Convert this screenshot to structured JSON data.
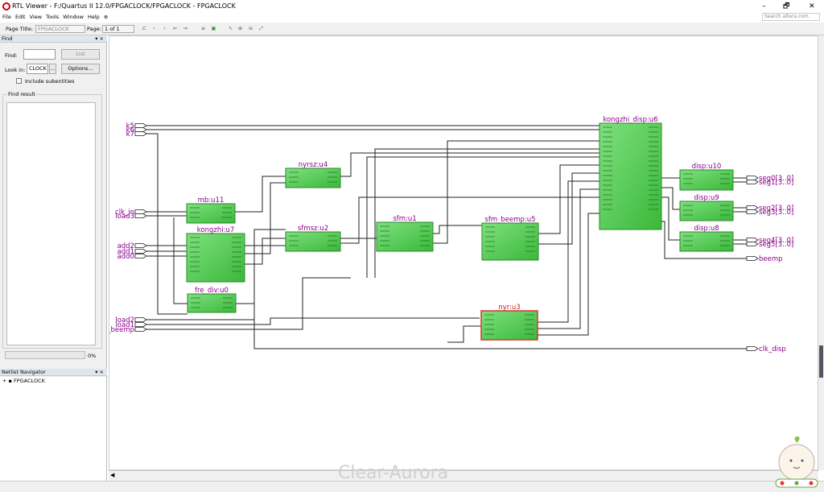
{
  "window": {
    "title": "RTL Viewer - F:/Quartus II 12.0/FPGACLOCK/FPGACLOCK - FPGACLOCK",
    "minimize": "–",
    "maximize": "🗗",
    "close": "✕"
  },
  "menu": [
    "File",
    "Edit",
    "View",
    "Tools",
    "Window",
    "Help",
    "⊕"
  ],
  "search_placeholder": "Search altera.com",
  "toolbar": {
    "page_title_label": "Page Title:",
    "page_title_value": "FPGACLOCK",
    "page_label": "Page:",
    "page_value": "1 of 1"
  },
  "find_panel": {
    "header": "Find",
    "find_label": "Find:",
    "list_button": "List",
    "look_in_label": "Look in:",
    "look_in_value": "CLOCK",
    "browse_button": "...",
    "options_button": "Options...",
    "include_subentities": "Include subentities",
    "find_result_label": "Find result",
    "progress": "0%"
  },
  "netlist_panel": {
    "header": "Netlist Navigator",
    "root": "FPGACLOCK"
  },
  "schematic": {
    "inputs_left": [
      "k5",
      "k6",
      "k7",
      "clk_in",
      "load3",
      "add2",
      "add1",
      "add0",
      "load2",
      "load1",
      "rl_beemp"
    ],
    "outputs_right": [
      "seg0[3..0]",
      "seg1[3..0]",
      "seg2[3..0]",
      "seg3[3..0]",
      "seg4[3..0]",
      "seg5[3..0]",
      "beemp",
      "clk_disp"
    ],
    "blocks": [
      "mb:u11",
      "kongzhi:u7",
      "fre_div:u0",
      "nyrsz:u4",
      "sfmsz:u2",
      "sfm:u1",
      "sfm_beemp:u5",
      "nyr:u3",
      "kongzhi_disp:u6",
      "disp:u10",
      "disp:u9",
      "disp:u8"
    ]
  },
  "watermark": "Clear-Aurora",
  "colors": {
    "block_fill": "#4cc94c",
    "block_border": "#2a8a2a",
    "port_text": "#8b008b",
    "highlight_border": "#e03030"
  }
}
